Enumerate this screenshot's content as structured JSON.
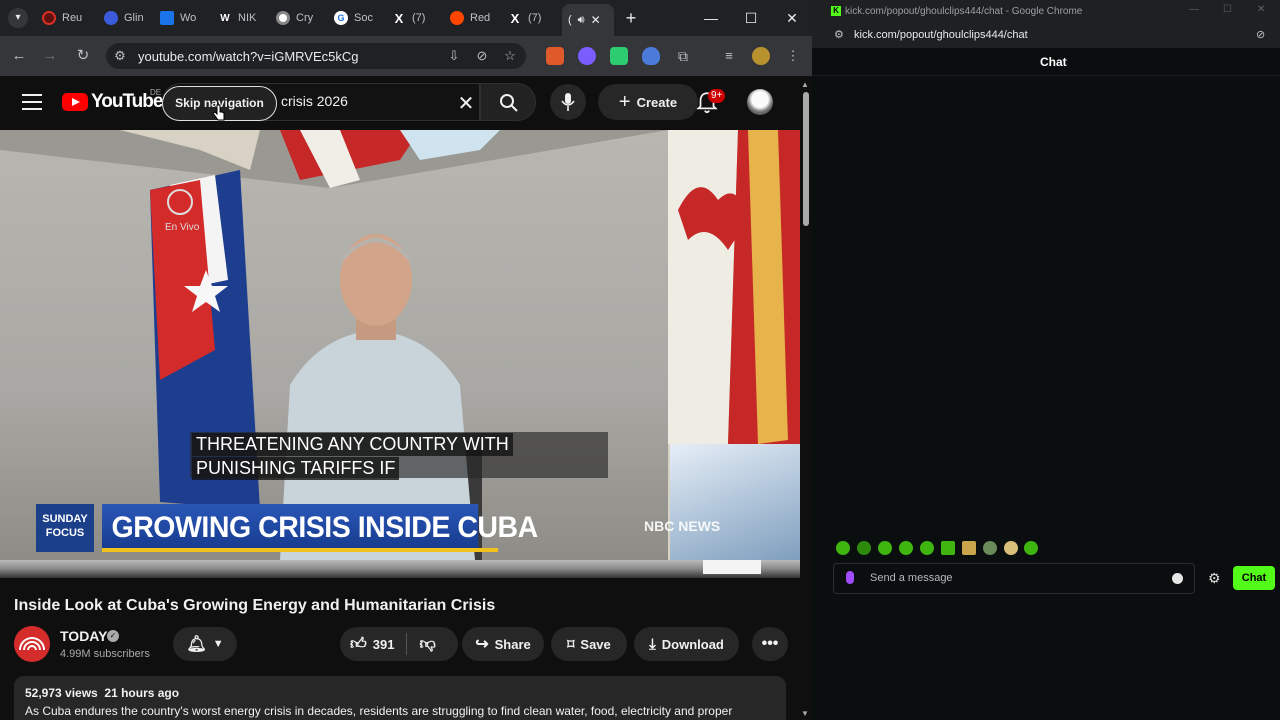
{
  "browser": {
    "tabs": [
      {
        "label": "Reu",
        "color": "#d93025"
      },
      {
        "label": "Glin",
        "color": "#3b5bdb"
      },
      {
        "label": "Wo",
        "color": "#1a73e8"
      },
      {
        "label": "NIK",
        "color": "#444444"
      },
      {
        "label": "Cry",
        "color": "#888888"
      },
      {
        "label": "Soc",
        "color": "#1a73e8"
      },
      {
        "label": "(7)",
        "color": "#000000"
      },
      {
        "label": "Red",
        "color": "#ff4500"
      },
      {
        "label": "(7)",
        "color": "#000000"
      },
      {
        "label": "(",
        "color": "#ff0000"
      }
    ],
    "new_tab": "+",
    "url": "youtube.com/watch?v=iGMRVEc5kCg"
  },
  "youtube": {
    "logo_text": "YouTube",
    "country": "DE",
    "skip_nav": "Skip navigation",
    "search_value": "crisis 2026",
    "create_label": "Create",
    "notifications_badge": "9+",
    "video": {
      "subtitle_line1": "THREATENING ANY COUNTRY WITH",
      "subtitle_line2": "PUNISHING TARIFFS IF",
      "show_badge": "SUNDAY FOCUS",
      "headline": "GROWING CRISIS INSIDE CUBA",
      "network": "NBC NEWS",
      "en_vivo": "En Vivo"
    },
    "title": "Inside Look at Cuba's Growing Energy and Humanitarian Crisis",
    "channel": {
      "name": "TODAY",
      "subscribers": "4.99M subscribers"
    },
    "actions": {
      "likes": "391",
      "share": "Share",
      "save": "Save",
      "download": "Download"
    },
    "description": {
      "views": "52,973 views",
      "age": "21 hours ago",
      "text": "As Cuba endures the country's worst energy crisis in decades, residents are struggling to find clean water, food, electricity and proper"
    }
  },
  "kick": {
    "window_title": "kick.com/popout/ghoulclips444/chat - Google Chrome",
    "url": "kick.com/popout/ghoulclips444/chat",
    "chat_title": "Chat",
    "message_placeholder": "Send a message",
    "chat_button": "Chat",
    "accent": "#53fc18"
  }
}
